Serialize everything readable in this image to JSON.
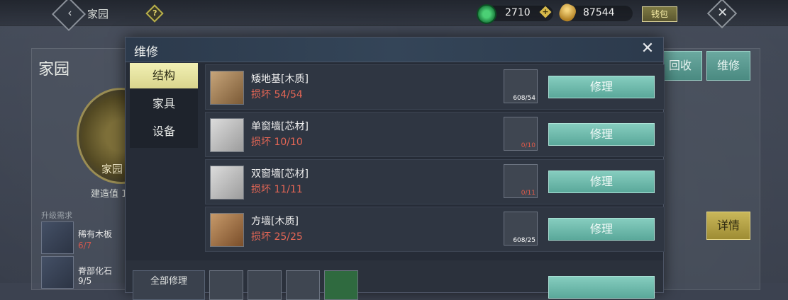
{
  "topbar": {
    "title": "家园",
    "back_icon": "‹",
    "help_icon": "?",
    "jade_value": "2710",
    "plus_icon": "+",
    "gold_value": "87544",
    "wallet_label": "钱包",
    "close_icon": "✕"
  },
  "background": {
    "left_title": "家园",
    "emblem_label": "家园",
    "build_text": "建造值 1",
    "upgrade_label": "升级需求",
    "requirements": [
      {
        "name": "稀有木板",
        "count": "6/7"
      },
      {
        "name": "脊部化石",
        "count": "9/5"
      }
    ],
    "buttons": [
      {
        "label": "回收"
      },
      {
        "label": "维修"
      }
    ],
    "detail_label": "详情"
  },
  "modal": {
    "title": "维修",
    "close_icon": "✕",
    "tabs": [
      {
        "label": "结构",
        "active": true
      },
      {
        "label": "家具",
        "active": false
      },
      {
        "label": "设备",
        "active": false
      }
    ],
    "rows": [
      {
        "name": "矮地基[木质]",
        "status": "损坏 54/54",
        "mat_count": "608/54",
        "mat_color": "#ffffff",
        "button": "修理",
        "icon": "plank-icon"
      },
      {
        "name": "单窗墙[芯材]",
        "status": "损坏 10/10",
        "mat_count": "0/10",
        "mat_color": "#e05a4a",
        "button": "修理",
        "icon": "window-wall-icon"
      },
      {
        "name": "双窗墙[芯材]",
        "status": "损坏 11/11",
        "mat_count": "0/11",
        "mat_color": "#e05a4a",
        "button": "修理",
        "icon": "double-window-wall-icon"
      },
      {
        "name": "方墙[木质]",
        "status": "损坏 25/25",
        "mat_count": "608/25",
        "mat_color": "#ffffff",
        "button": "修理",
        "icon": "wood-wall-icon"
      }
    ],
    "repair_all_label": "全部修理"
  }
}
